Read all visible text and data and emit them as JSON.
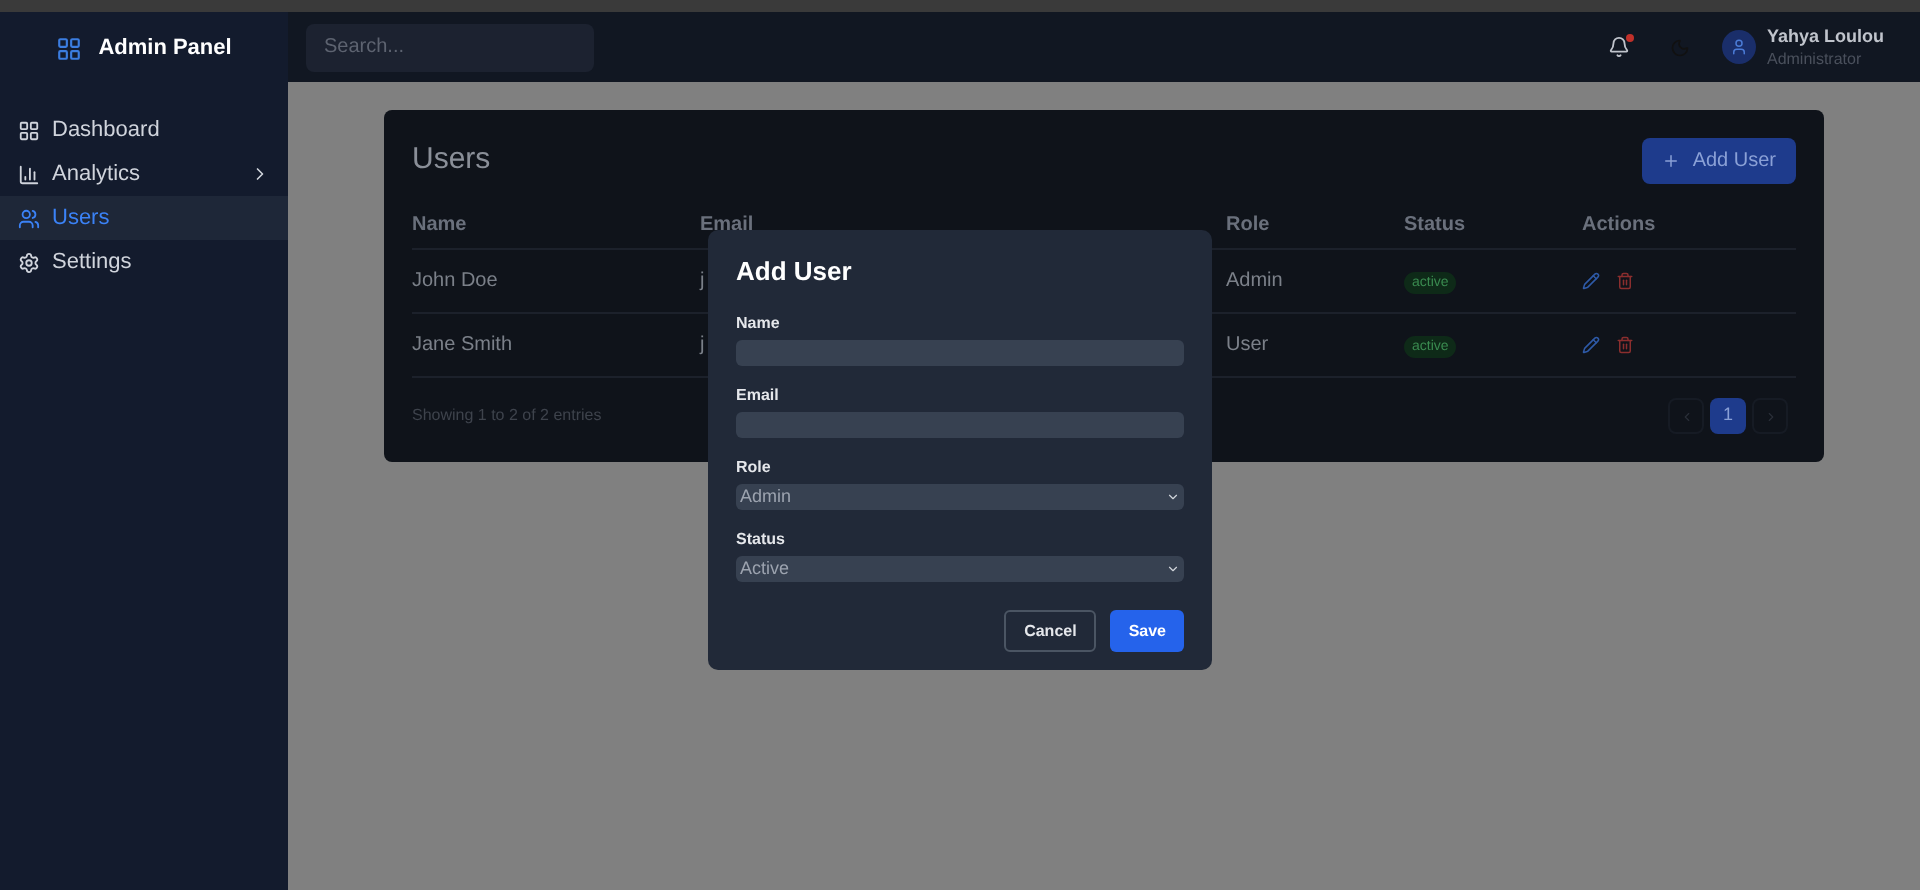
{
  "sidebar": {
    "brand": "Admin Panel",
    "items": [
      {
        "label": "Dashboard",
        "selected": false,
        "has_submenu": false
      },
      {
        "label": "Analytics",
        "selected": false,
        "has_submenu": true
      },
      {
        "label": "Users",
        "selected": true,
        "has_submenu": false
      },
      {
        "label": "Settings",
        "selected": false,
        "has_submenu": false
      }
    ]
  },
  "header": {
    "search": {
      "placeholder": "Search..."
    },
    "notifications_unread": true,
    "user": {
      "name": "Yahya Loulou",
      "role": "Administrator"
    }
  },
  "users_card": {
    "title": "Users",
    "add_button": "Add User",
    "columns": [
      "Name",
      "Email",
      "Role",
      "Status",
      "Actions"
    ],
    "rows": [
      {
        "name": "John Doe",
        "email": "j",
        "role": "Admin",
        "status": "active"
      },
      {
        "name": "Jane Smith",
        "email": "j",
        "role": "User",
        "status": "active"
      }
    ],
    "footer": "Showing 1 to 2 of 2 entries",
    "pages": [
      {
        "label": "1",
        "selected": true
      }
    ]
  },
  "modal": {
    "title": "Add User",
    "fields": [
      {
        "label": "Name",
        "kind": "text"
      },
      {
        "label": "Email",
        "kind": "text"
      },
      {
        "label": "Role",
        "kind": "select",
        "value": "Admin"
      },
      {
        "label": "Status",
        "kind": "select",
        "value": "Active"
      }
    ],
    "buttons": [
      {
        "label": "Cancel",
        "kind": "secondary"
      },
      {
        "label": "Save",
        "kind": "primary"
      }
    ]
  }
}
